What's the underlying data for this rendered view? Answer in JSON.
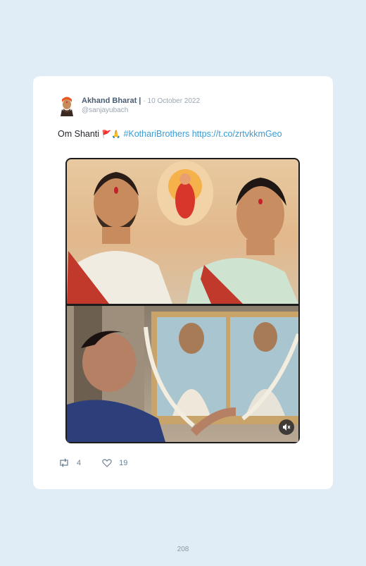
{
  "tweet": {
    "author": "Akhand Bharat |",
    "date": "· 10 October 2022",
    "handle": "@sanjayubach",
    "text_prefix": "Om Shanti",
    "emojis": "🚩🙏",
    "hashtag": "#KothariBrothers",
    "link": "https://t.co/zrtvkkmGeo"
  },
  "stats": {
    "retweets": "4",
    "likes": "19"
  },
  "icons": {
    "avatar": "avatar-image",
    "retweet": "retweet-icon",
    "like": "heart-icon",
    "mute": "mute-icon"
  },
  "page_number": "208"
}
